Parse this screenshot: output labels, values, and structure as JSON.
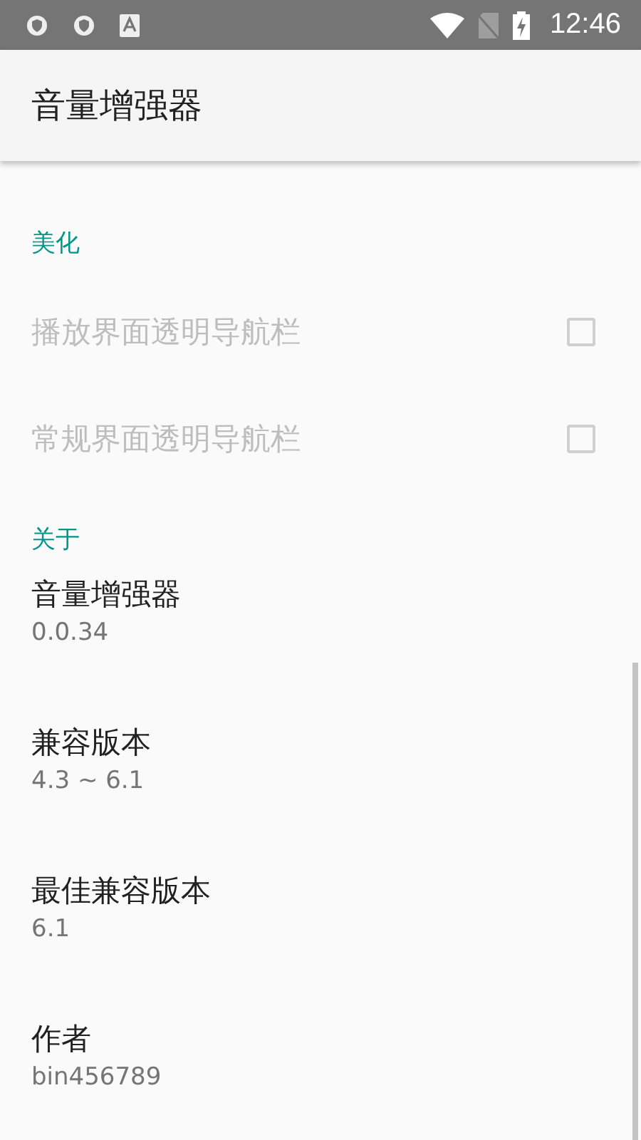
{
  "status_bar": {
    "time": "12:46"
  },
  "app_bar": {
    "title": "音量增强器"
  },
  "sections": [
    {
      "header": "美化",
      "items": [
        {
          "kind": "checkbox",
          "title": "播放界面透明导航栏",
          "checked": false,
          "disabled": true
        },
        {
          "kind": "checkbox",
          "title": "常规界面透明导航栏",
          "checked": false,
          "disabled": true
        }
      ]
    },
    {
      "header": "关于",
      "items": [
        {
          "kind": "info",
          "title": "音量增强器",
          "summary": "0.0.34"
        },
        {
          "kind": "info",
          "title": "兼容版本",
          "summary": "4.3 ~ 6.1"
        },
        {
          "kind": "info",
          "title": "最佳兼容版本",
          "summary": "6.1"
        },
        {
          "kind": "info",
          "title": "作者",
          "summary": "bin456789"
        }
      ]
    }
  ]
}
